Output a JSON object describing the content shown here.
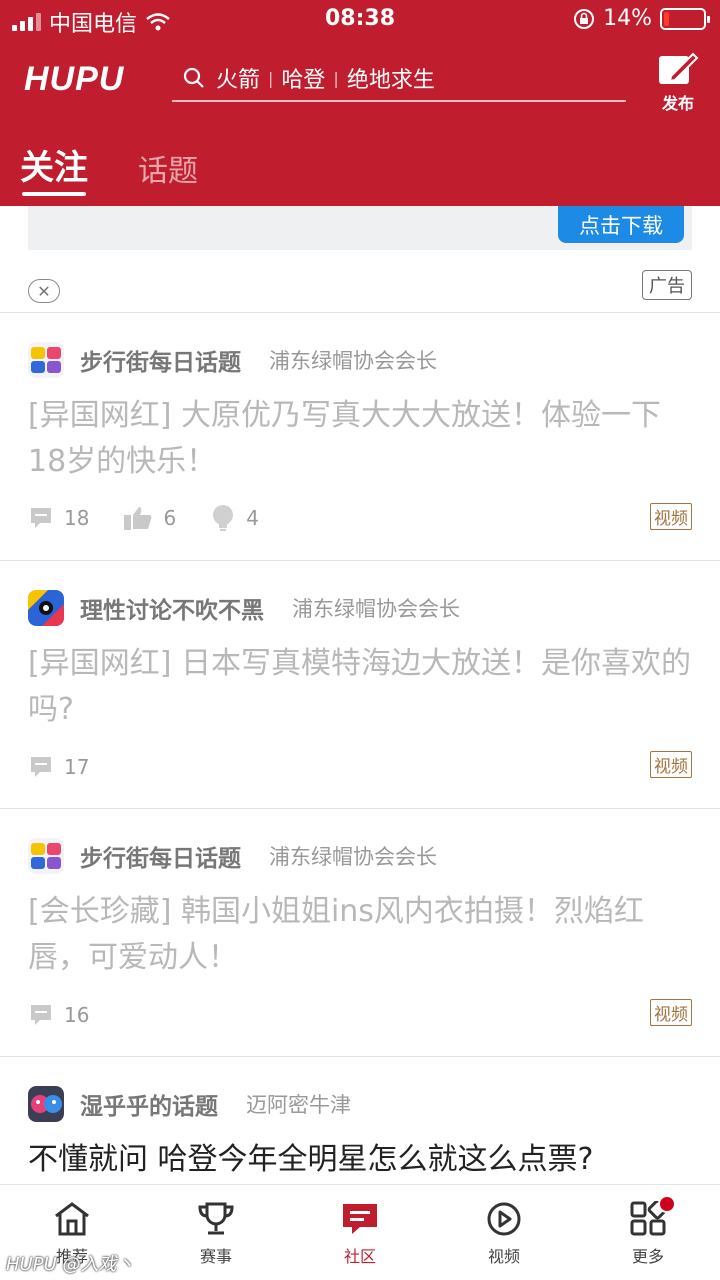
{
  "status_bar": {
    "carrier": "中国电信",
    "time": "08:38",
    "battery": "14%",
    "battery_level": 0.14
  },
  "header": {
    "logo": "HUPU",
    "search_terms": [
      "火箭",
      "哈登",
      "绝地求生"
    ],
    "publish_label": "发布",
    "tabs": [
      {
        "label": "关注",
        "active": true
      },
      {
        "label": "话题",
        "active": false
      }
    ]
  },
  "ad": {
    "download_label": "点击下载",
    "badge": "广告",
    "close_glyph": "✕"
  },
  "posts": [
    {
      "group": "步行街每日话题",
      "author": "浦东绿帽协会会长",
      "title": "[异国网红] 大原优乃写真大大大放送！体验一下18岁的快乐！",
      "comments": "18",
      "likes": "6",
      "lights": "4",
      "tag": "视频"
    },
    {
      "group": "理性讨论不吹不黑",
      "author": "浦东绿帽协会会长",
      "title": "[异国网红] 日本写真模特海边大放送！是你喜欢的吗?",
      "comments": "17",
      "tag": "视频"
    },
    {
      "group": "步行街每日话题",
      "author": "浦东绿帽协会会长",
      "title": "[会长珍藏] 韩国小姐姐ins风内衣拍摄！烈焰红唇，可爱动人！",
      "comments": "16",
      "tag": "视频"
    },
    {
      "group": "湿乎乎的话题",
      "author": "迈阿密牛津",
      "title": "不懂就问 哈登今年全明星怎么就这么点票?"
    }
  ],
  "bottom_nav": [
    {
      "label": "推荐",
      "icon": "home-icon"
    },
    {
      "label": "赛事",
      "icon": "trophy-icon"
    },
    {
      "label": "社区",
      "icon": "community-icon",
      "active": true
    },
    {
      "label": "视频",
      "icon": "play-icon"
    },
    {
      "label": "更多",
      "icon": "grid-icon"
    }
  ],
  "watermark": "HUPU @入戏丶",
  "colors": {
    "brand_red": "#c01e2f",
    "video_tag": "#a4743f",
    "download_blue": "#1d8be6"
  }
}
